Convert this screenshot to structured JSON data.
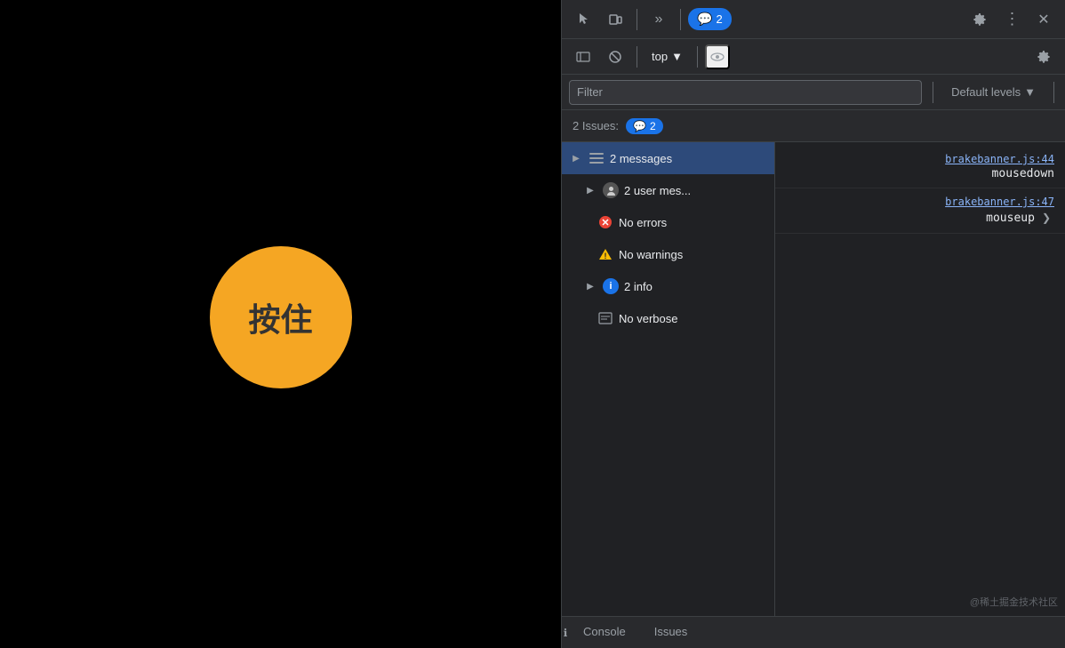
{
  "left_panel": {
    "circle_text": "按住",
    "background": "#000000",
    "circle_color": "#F5A623"
  },
  "devtools": {
    "toolbar_top": {
      "cursor_btn": "⊹",
      "device_btn": "▭",
      "more_btn": "»",
      "messages_count": "2",
      "settings_btn": "⚙",
      "more_options_btn": "⋮",
      "close_btn": "✕"
    },
    "toolbar_second": {
      "sidebar_btn": "◫",
      "block_btn": "⊘",
      "top_label": "top",
      "top_arrow": "▼",
      "eye_btn": "👁",
      "settings_btn": "⚙"
    },
    "filter": {
      "placeholder": "Filter",
      "default_levels_label": "Default levels",
      "default_levels_arrow": "▼"
    },
    "issues_bar": {
      "label": "2 Issues:",
      "badge_icon": "💬",
      "badge_count": "2"
    },
    "message_tree": {
      "items": [
        {
          "id": "messages",
          "icon_type": "list",
          "label": "2 messages",
          "has_arrow": true,
          "selected": true
        },
        {
          "id": "user-messages",
          "icon_type": "user",
          "label": "2 user mes...",
          "has_arrow": true,
          "indented": true
        },
        {
          "id": "no-errors",
          "icon_type": "error",
          "label": "No errors",
          "has_arrow": false,
          "indented": true
        },
        {
          "id": "no-warnings",
          "icon_type": "warning",
          "label": "No warnings",
          "has_arrow": false,
          "indented": true
        },
        {
          "id": "info",
          "icon_type": "info",
          "label": "2 info",
          "has_arrow": true,
          "indented": true
        },
        {
          "id": "no-verbose",
          "icon_type": "verbose",
          "label": "No verbose",
          "has_arrow": false,
          "indented": true
        }
      ]
    },
    "messages": [
      {
        "link": "brakebanner.js:44",
        "event": "mousedown"
      },
      {
        "link": "brakebanner.js:47",
        "event": "mouseup",
        "has_expand": true
      }
    ],
    "bottom_tabs": [
      {
        "label": "Console",
        "active": false
      },
      {
        "label": "Issues",
        "active": false
      }
    ],
    "watermark": "@稀土掘金技术社区"
  }
}
